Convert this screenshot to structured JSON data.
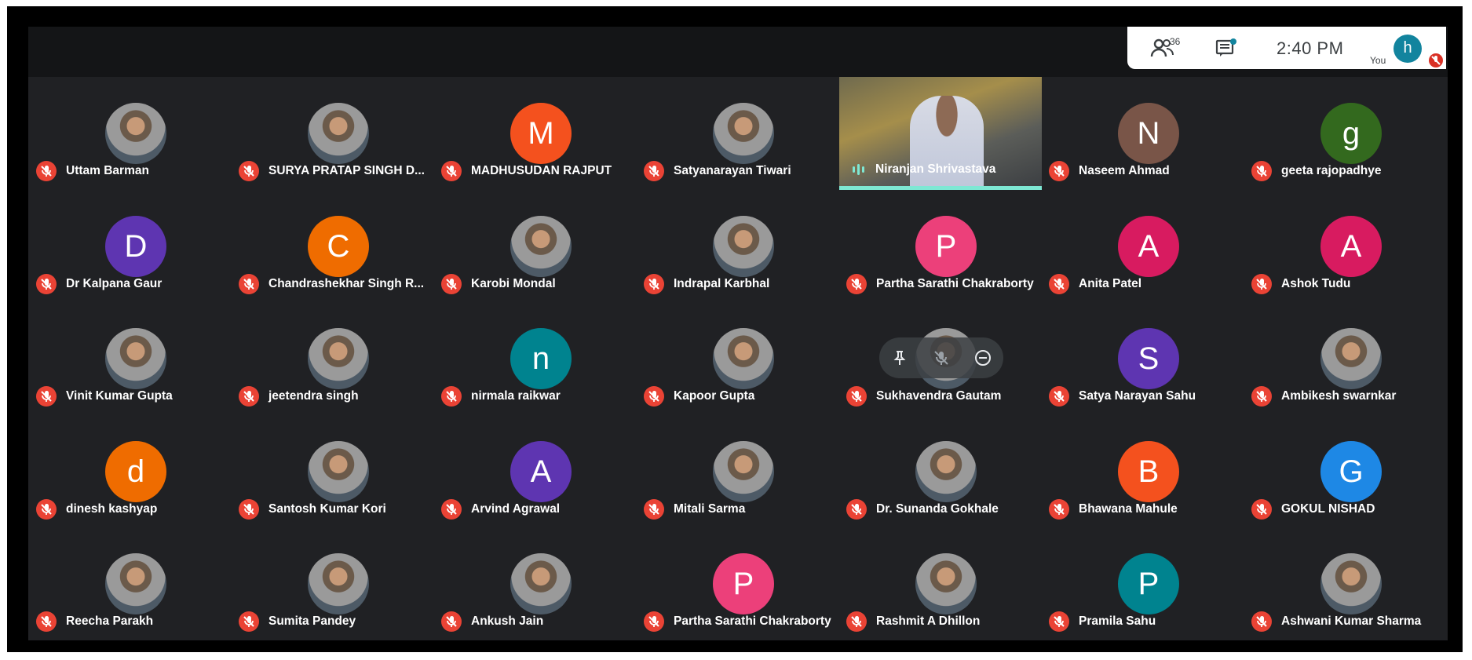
{
  "header": {
    "people_count": "36",
    "time": "2:40 PM",
    "you_label": "You",
    "you_initial": "h"
  },
  "colors": {
    "mic_off": "#ea4335",
    "speaking_bar": "#7ee8d4"
  },
  "participants": [
    {
      "name": "Uttam Barman",
      "avatar": "photo"
    },
    {
      "name": "SURYA PRATAP SINGH D...",
      "avatar": "photo"
    },
    {
      "name": "MADHUSUDAN RAJPUT",
      "avatar": "M",
      "color": "#f4511e"
    },
    {
      "name": "Satyanarayan Tiwari",
      "avatar": "photo"
    },
    {
      "name": "Niranjan Shrivastava",
      "video": true
    },
    {
      "name": "Naseem Ahmad",
      "avatar": "N",
      "color": "#795548"
    },
    {
      "name": "geeta rajopadhye",
      "avatar": "g",
      "color": "#33691e"
    },
    {
      "name": "Dr Kalpana Gaur",
      "avatar": "D",
      "color": "#5e35b1"
    },
    {
      "name": "Chandrashekhar Singh R...",
      "avatar": "C",
      "color": "#ef6c00"
    },
    {
      "name": "Karobi Mondal",
      "avatar": "photo"
    },
    {
      "name": "Indrapal Karbhal",
      "avatar": "photo"
    },
    {
      "name": "Partha Sarathi Chakraborty",
      "avatar": "P",
      "color": "#ec407a"
    },
    {
      "name": "Anita Patel",
      "avatar": "A",
      "color": "#d81b60"
    },
    {
      "name": "Ashok Tudu",
      "avatar": "A",
      "color": "#d81b60"
    },
    {
      "name": "Vinit Kumar Gupta",
      "avatar": "photo"
    },
    {
      "name": "jeetendra singh",
      "avatar": "photo"
    },
    {
      "name": "nirmala raikwar",
      "avatar": "n",
      "color": "#00838f"
    },
    {
      "name": "Kapoor Gupta",
      "avatar": "photo"
    },
    {
      "name": "Sukhavendra Gautam",
      "avatar": "photo"
    },
    {
      "name": "Satya Narayan Sahu",
      "avatar": "S",
      "color": "#5e35b1"
    },
    {
      "name": "Ambikesh swarnkar",
      "avatar": "photo"
    },
    {
      "name": "dinesh kashyap",
      "avatar": "d",
      "color": "#ef6c00"
    },
    {
      "name": "Santosh Kumar Kori",
      "avatar": "photo"
    },
    {
      "name": "Arvind Agrawal",
      "avatar": "A",
      "color": "#5e35b1"
    },
    {
      "name": "Mitali Sarma",
      "avatar": "photo"
    },
    {
      "name": "Dr. Sunanda Gokhale",
      "avatar": "photo"
    },
    {
      "name": "Bhawana Mahule",
      "avatar": "B",
      "color": "#f4511e"
    },
    {
      "name": "GOKUL NISHAD",
      "avatar": "G",
      "color": "#1e88e5"
    },
    {
      "name": "Reecha Parakh",
      "avatar": "photo"
    },
    {
      "name": "Sumita Pandey",
      "avatar": "photo"
    },
    {
      "name": "Ankush Jain",
      "avatar": "photo"
    },
    {
      "name": "Partha Sarathi Chakraborty",
      "avatar": "P",
      "color": "#ec407a"
    },
    {
      "name": "Rashmit A Dhillon",
      "avatar": "photo"
    },
    {
      "name": "Pramila Sahu",
      "avatar": "P",
      "color": "#00838f"
    },
    {
      "name": "Ashwani Kumar Sharma",
      "avatar": "photo"
    }
  ]
}
